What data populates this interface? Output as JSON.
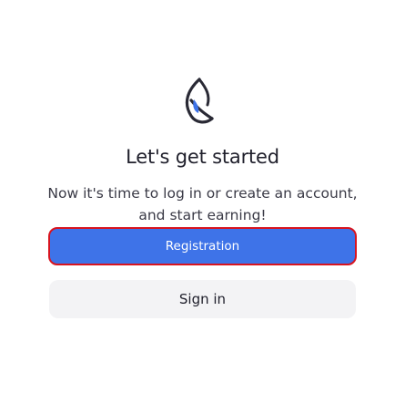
{
  "logo": {
    "icon": "leaf-drop-logo-icon"
  },
  "header": {
    "title": "Let's get started",
    "subtitle": "Now it's time to log in or create an account, and start earning!"
  },
  "actions": {
    "registration_label": "Registration",
    "sign_in_label": "Sign in"
  },
  "colors": {
    "primary": "#3e73e8",
    "primary_border": "#d8141f",
    "secondary_bg": "#f3f3f5",
    "text_dark": "#1f1f2b"
  }
}
